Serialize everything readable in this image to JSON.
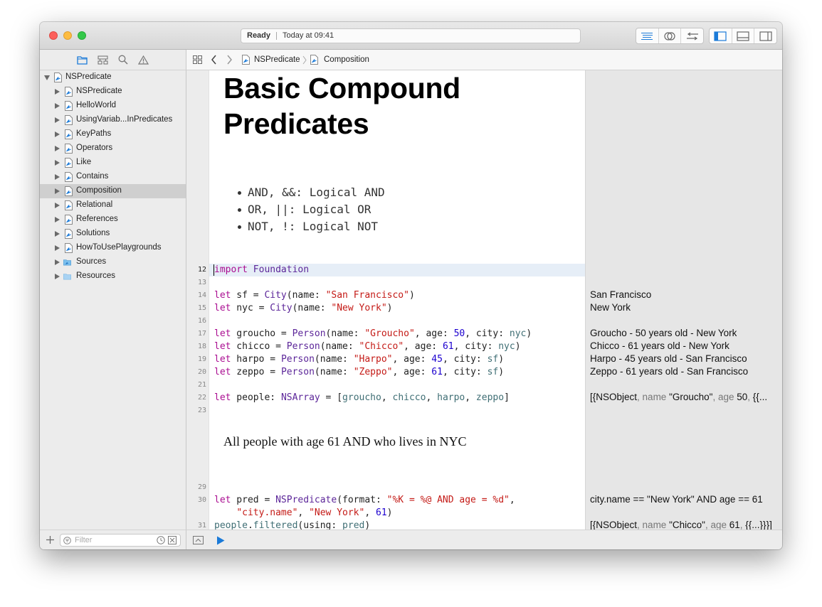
{
  "window": {
    "status_ready": "Ready",
    "status_time": "Today at 09:41"
  },
  "jumpbar": {
    "crumbs": [
      "NSPredicate",
      "Composition"
    ]
  },
  "navigator": {
    "root": "NSPredicate",
    "items": [
      {
        "label": "NSPredicate"
      },
      {
        "label": "HelloWorld"
      },
      {
        "label": "UsingVariab...InPredicates"
      },
      {
        "label": "KeyPaths"
      },
      {
        "label": "Operators"
      },
      {
        "label": "Like"
      },
      {
        "label": "Contains"
      },
      {
        "label": "Composition"
      },
      {
        "label": "Relational"
      },
      {
        "label": "References"
      },
      {
        "label": "Solutions"
      },
      {
        "label": "HowToUsePlaygrounds"
      },
      {
        "label": "Sources"
      },
      {
        "label": "Resources"
      }
    ],
    "selected_index": 7,
    "filter_placeholder": "Filter"
  },
  "doc": {
    "title_line1": "Basic Compound",
    "title_line2": "Predicates",
    "bullets": [
      "AND, &&: Logical AND",
      "OR, ||: Logical OR",
      "NOT, !: Logical NOT"
    ],
    "prose": "All people with age 61 AND who lives in NYC"
  },
  "code": {
    "lines": [
      {
        "n": "12",
        "text": "import Foundation"
      },
      {
        "n": "13",
        "text": ""
      },
      {
        "n": "14",
        "text": "let sf = City(name: \"San Francisco\")"
      },
      {
        "n": "15",
        "text": "let nyc = City(name: \"New York\")"
      },
      {
        "n": "16",
        "text": ""
      },
      {
        "n": "17",
        "text": "let groucho = Person(name: \"Groucho\", age: 50, city: nyc)"
      },
      {
        "n": "18",
        "text": "let chicco = Person(name: \"Chicco\", age: 61, city: nyc)"
      },
      {
        "n": "19",
        "text": "let harpo = Person(name: \"Harpo\", age: 45, city: sf)"
      },
      {
        "n": "20",
        "text": "let zeppo = Person(name: \"Zeppo\", age: 61, city: sf)"
      },
      {
        "n": "21",
        "text": ""
      },
      {
        "n": "22",
        "text": "let people: NSArray = [groucho, chicco, harpo, zeppo]"
      },
      {
        "n": "23",
        "text": ""
      },
      {
        "n": "29",
        "text": ""
      },
      {
        "n": "30",
        "text": "let pred = NSPredicate(format: \"%K = %@ AND age = %d\","
      },
      {
        "n": "",
        "text": "    \"city.name\", \"New York\", 61)"
      },
      {
        "n": "31",
        "text": "people.filtered(using: pred)"
      }
    ]
  },
  "results": {
    "r14": "San Francisco",
    "r15": "New York",
    "r17": "Groucho - 50 years old - New York",
    "r18": "Chicco - 61 years old - New York",
    "r19": "Harpo - 45 years old - San Francisco",
    "r20": "Zeppo - 61 years old - San Francisco",
    "r22": "[{NSObject, name \"Groucho\", age 50, {{...",
    "r30": "city.name == \"New York\" AND age == 61",
    "r31": "[{NSObject, name \"Chicco\", age 61, {{...}}}]"
  },
  "icons": {
    "navigator_tabs": [
      "folder-icon",
      "hierarchy-icon",
      "search-icon",
      "warning-icon"
    ],
    "toolbar_editor": [
      "standard-editor-icon",
      "assistant-editor-icon",
      "version-editor-icon"
    ],
    "toolbar_view": [
      "navigator-panel-icon",
      "debug-panel-icon",
      "utilities-panel-icon"
    ]
  },
  "colors": {
    "keyword": "#aa0d91",
    "type": "#5c2699",
    "string": "#c41a16",
    "number": "#1c00cf",
    "selection": "#cfcfcf",
    "accent": "#1a7ad8"
  }
}
